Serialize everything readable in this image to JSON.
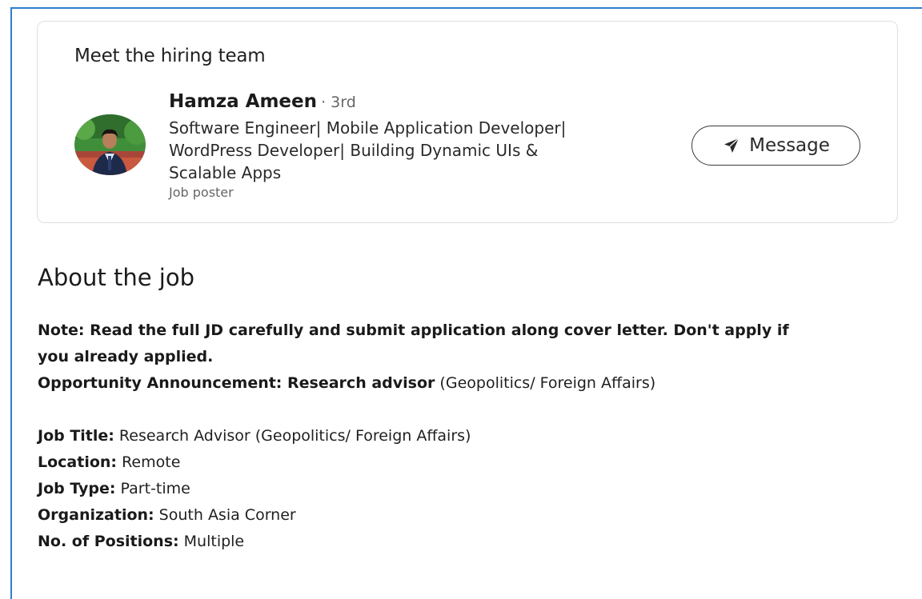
{
  "hiring_team": {
    "title": "Meet the hiring team",
    "person": {
      "name": "Hamza Ameen",
      "degree": "· 3rd",
      "headline_lines": [
        "Software Engineer| Mobile Application Developer|",
        "WordPress Developer| Building Dynamic UIs &",
        "Scalable Apps"
      ],
      "role": "Job poster"
    },
    "message_button": {
      "icon": "send-icon",
      "label": "Message"
    }
  },
  "about": {
    "title": "About the job",
    "note_lines": [
      "Note: Read the full JD carefully and submit application along cover letter. Don't apply if",
      "you already applied."
    ],
    "announcement": {
      "label": "Opportunity Announcement: Research advisor",
      "value": " (Geopolitics/ Foreign Affairs)"
    },
    "details": [
      {
        "label": "Job Title:",
        "value": " Research Advisor (Geopolitics/ Foreign Affairs)"
      },
      {
        "label": "Location:",
        "value": " Remote"
      },
      {
        "label": "Job Type:",
        "value": " Part-time"
      },
      {
        "label": "Organization:",
        "value": " South Asia Corner"
      },
      {
        "label": "No. of Positions:",
        "value": " Multiple"
      }
    ]
  },
  "colors": {
    "frame_accent": "#2f7fd0",
    "card_border": "#dfdfdf"
  }
}
